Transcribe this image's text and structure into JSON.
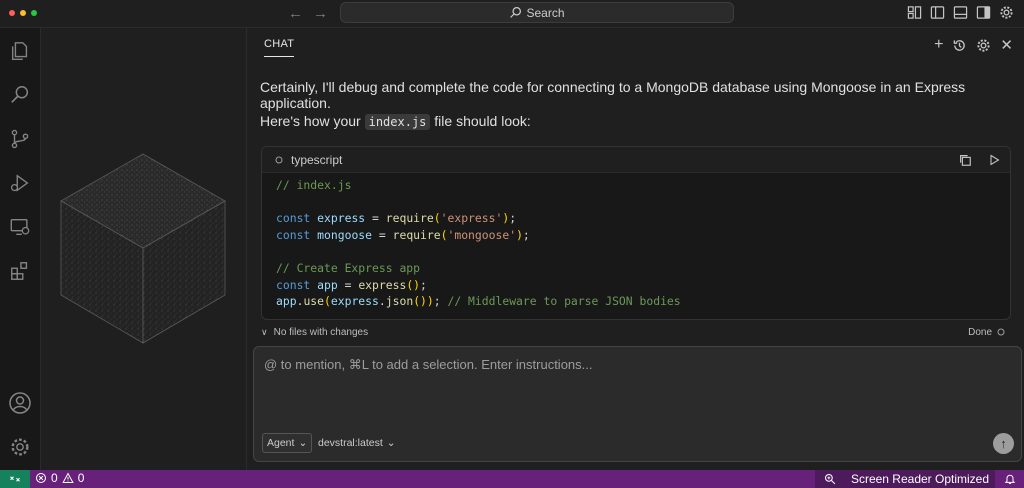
{
  "titlebar": {
    "search_label": "Search"
  },
  "chat": {
    "tab_label": "CHAT",
    "intro_message": "Certainly, I'll debug and complete the code for connecting to a MongoDB database using Mongoose in an Express application.",
    "file_message_prefix": "Here's how your",
    "file_name": "index.js",
    "file_message_suffix": "file should look:",
    "code_language": "typescript",
    "code": {
      "line1_comment": "// index.js",
      "line3_kw": "const",
      "line3_var": "express",
      "line3_eq": " = ",
      "line3_fn": "require",
      "line3_str": "'express'",
      "line4_kw": "const",
      "line4_var": "mongoose",
      "line4_eq": " = ",
      "line4_fn": "require",
      "line4_str": "'mongoose'",
      "line6_comment": "// Create Express app",
      "line7_kw": "const",
      "line7_var": "app",
      "line7_eq": " = ",
      "line7_fn": "express",
      "line8_var1": "app",
      "line8_fn1": "use",
      "line8_var2": "express",
      "line8_fn2": "json",
      "line8_comment": "// Middleware to parse JSON bodies"
    },
    "changes_label": "No files with changes",
    "done_label": "Done",
    "input_placeholder": "@ to mention, ⌘L to add a selection. Enter instructions...",
    "mode_label": "Agent",
    "model_label": "devstral:latest"
  },
  "statusbar": {
    "errors": "0",
    "warnings": "0",
    "screen_reader": "Screen Reader Optimized"
  }
}
